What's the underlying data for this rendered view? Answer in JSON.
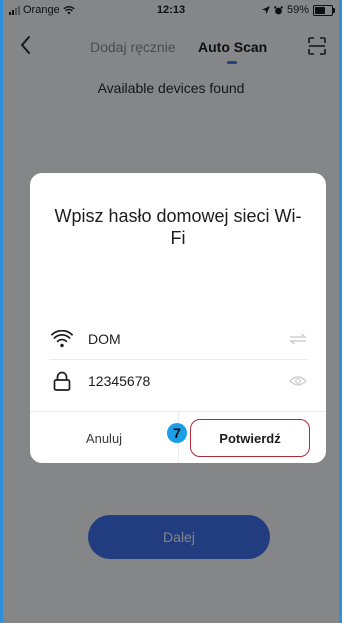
{
  "status_bar": {
    "carrier": "Orange",
    "time": "12:13",
    "battery": "59%"
  },
  "header": {
    "tabs": [
      {
        "label": "Dodaj ręcznie",
        "active": false
      },
      {
        "label": "Auto Scan",
        "active": true
      }
    ]
  },
  "main": {
    "found_text": "Available devices found",
    "next_label": "Dalej"
  },
  "dialog": {
    "title": "Wpisz hasło domowej sieci Wi-Fi",
    "network_name": "DOM",
    "password": "12345678",
    "cancel_label": "Anuluj",
    "confirm_label": "Potwierdź",
    "step_badge": "7"
  },
  "colors": {
    "accent": "#3d6ee8",
    "highlight": "#b02a3a",
    "badge": "#1a9fe6"
  }
}
